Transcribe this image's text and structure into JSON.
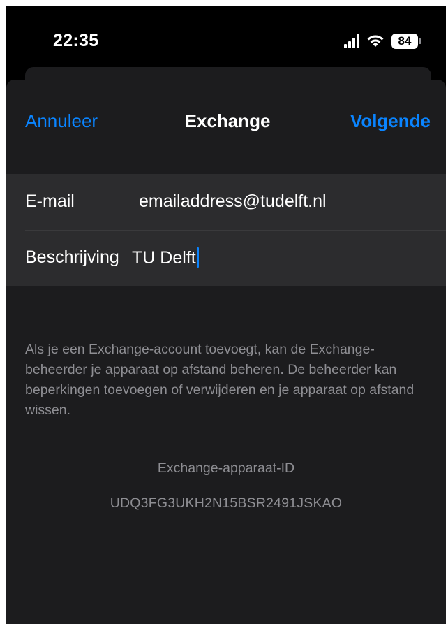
{
  "status_bar": {
    "time": "22:35",
    "battery_level": "84",
    "icons": [
      "cellular-signal-icon",
      "wifi-icon",
      "battery-icon"
    ]
  },
  "nav": {
    "cancel_label": "Annuleer",
    "title": "Exchange",
    "next_label": "Volgende"
  },
  "form": {
    "email_label": "E-mail",
    "email_value": "emailaddress@tudelft.nl",
    "description_label": "Beschrijving",
    "description_value": "TU Delft"
  },
  "footer": {
    "notice": "Als je een Exchange-account toevoegt, kan de Exchange-beheerder je apparaat op afstand beheren. De beheerder kan beperkingen toevoegen of verwijderen en je apparaat op afstand wissen.",
    "device_id_label": "Exchange-apparaat-ID",
    "device_id_value": "UDQ3FG3UKH2N15BSR2491JSKAO"
  },
  "colors": {
    "accent": "#0a84ff",
    "background": "#000000",
    "sheet": "#1c1c1e",
    "group": "#2c2c2e",
    "secondary_text": "#8e8e93"
  }
}
